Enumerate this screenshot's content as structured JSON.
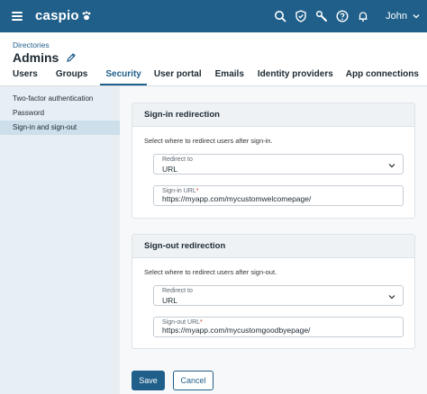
{
  "app": {
    "brand": "caspio",
    "user_name": "John",
    "icons": [
      "menu-icon",
      "search-icon",
      "shield-icon",
      "wrench-icon",
      "help-icon",
      "bell-icon",
      "chevron-down-icon"
    ],
    "brand_color": "#1f5f8a"
  },
  "header": {
    "breadcrumb": "Directories",
    "title": "Admins"
  },
  "tabs": [
    {
      "label": "Users"
    },
    {
      "label": "Groups"
    },
    {
      "label": "Security",
      "active": true
    },
    {
      "label": "User portal"
    },
    {
      "label": "Emails"
    },
    {
      "label": "Identity providers"
    },
    {
      "label": "App connections"
    }
  ],
  "sidebar": {
    "items": [
      {
        "label": "Two-factor authentication"
      },
      {
        "label": "Password"
      },
      {
        "label": "Sign-in and sign-out",
        "active": true
      }
    ]
  },
  "signin": {
    "heading": "Sign-in redirection",
    "description": "Select where to redirect users after sign-in.",
    "redirect_label": "Redirect to",
    "redirect_value": "URL",
    "url_label": "Sign-in URL",
    "required_mark": "*",
    "url_value": "https://myapp.com/mycustomwelcomepage/"
  },
  "signout": {
    "heading": "Sign-out redirection",
    "description": "Select where to redirect users after sign-out.",
    "redirect_label": "Redirect to",
    "redirect_value": "URL",
    "url_label": "Sign-out URL",
    "required_mark": "*",
    "url_value": "https://myapp.com/mycustomgoodbyepage/"
  },
  "actions": {
    "save_label": "Save",
    "cancel_label": "Cancel"
  }
}
